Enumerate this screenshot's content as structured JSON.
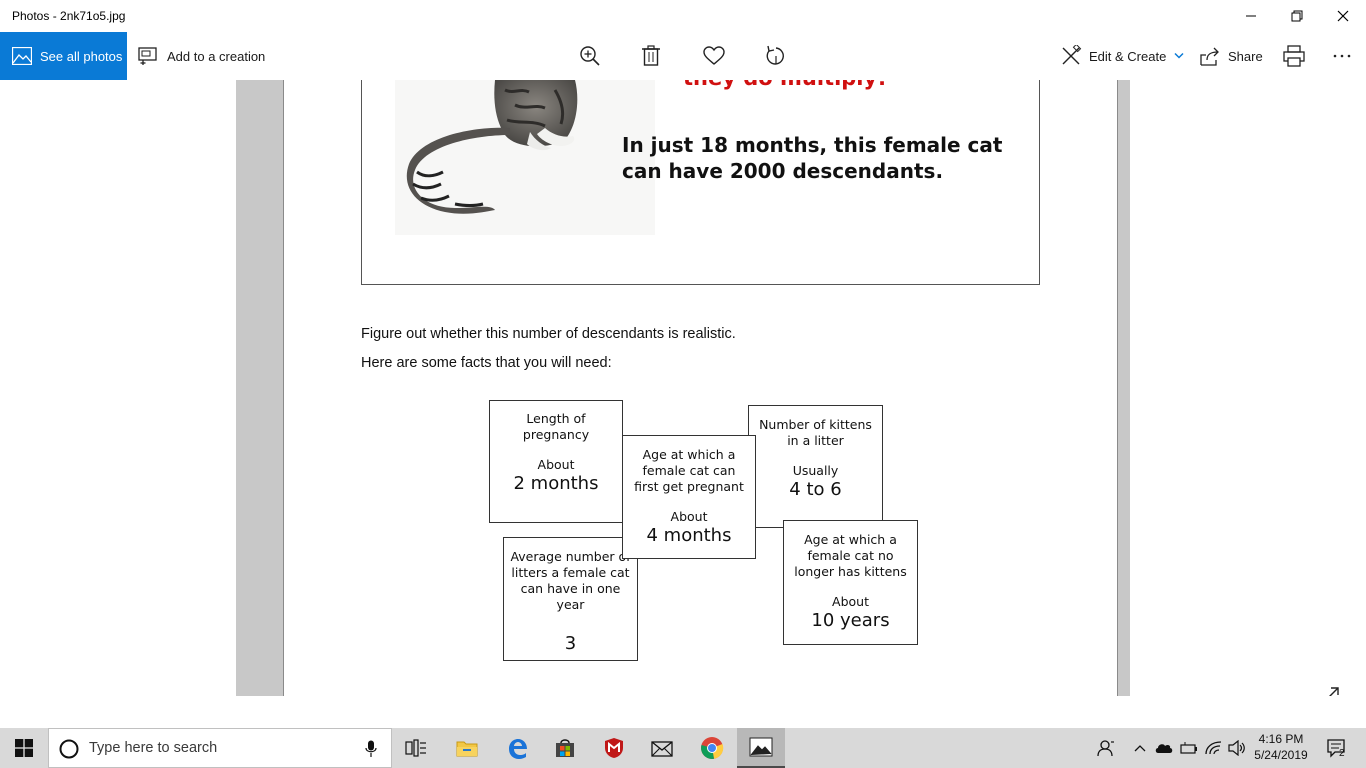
{
  "window": {
    "title": "Photos - 2nk71o5.jpg"
  },
  "toolbar": {
    "see_all_label": "See all photos",
    "add_creation_label": "Add to a creation",
    "edit_create_label": "Edit & Create",
    "share_label": "Share"
  },
  "document": {
    "red_heading": "they do multiply!",
    "cat_claim": "In just 18 months, this female cat can have 2000 descendants.",
    "instruction": "Figure out whether this number of descendants is realistic.",
    "facts_intro": "Here are some facts that you will need:",
    "cards": {
      "pregnancy": {
        "desc": "Length of pregnancy",
        "qual": "About",
        "value": "2 months"
      },
      "first_pregnant": {
        "desc": "Age at which a female cat can first get pregnant",
        "qual": "About",
        "value": "4 months"
      },
      "kittens": {
        "desc": "Number of kittens in a litter",
        "qual": "Usually",
        "value": "4 to 6"
      },
      "litters": {
        "desc": "Average number of litters a female cat can have in one year",
        "qual": "",
        "value": "3"
      },
      "no_longer": {
        "desc": "Age at which a female cat no longer has kittens",
        "qual": "About",
        "value": "10 years"
      }
    }
  },
  "taskbar": {
    "search_placeholder": "Type here to search",
    "time": "4:16 PM",
    "date": "5/24/2019",
    "notification_count": "2"
  },
  "colors": {
    "accent": "#0a7ad6",
    "heading_red": "#d01010"
  }
}
